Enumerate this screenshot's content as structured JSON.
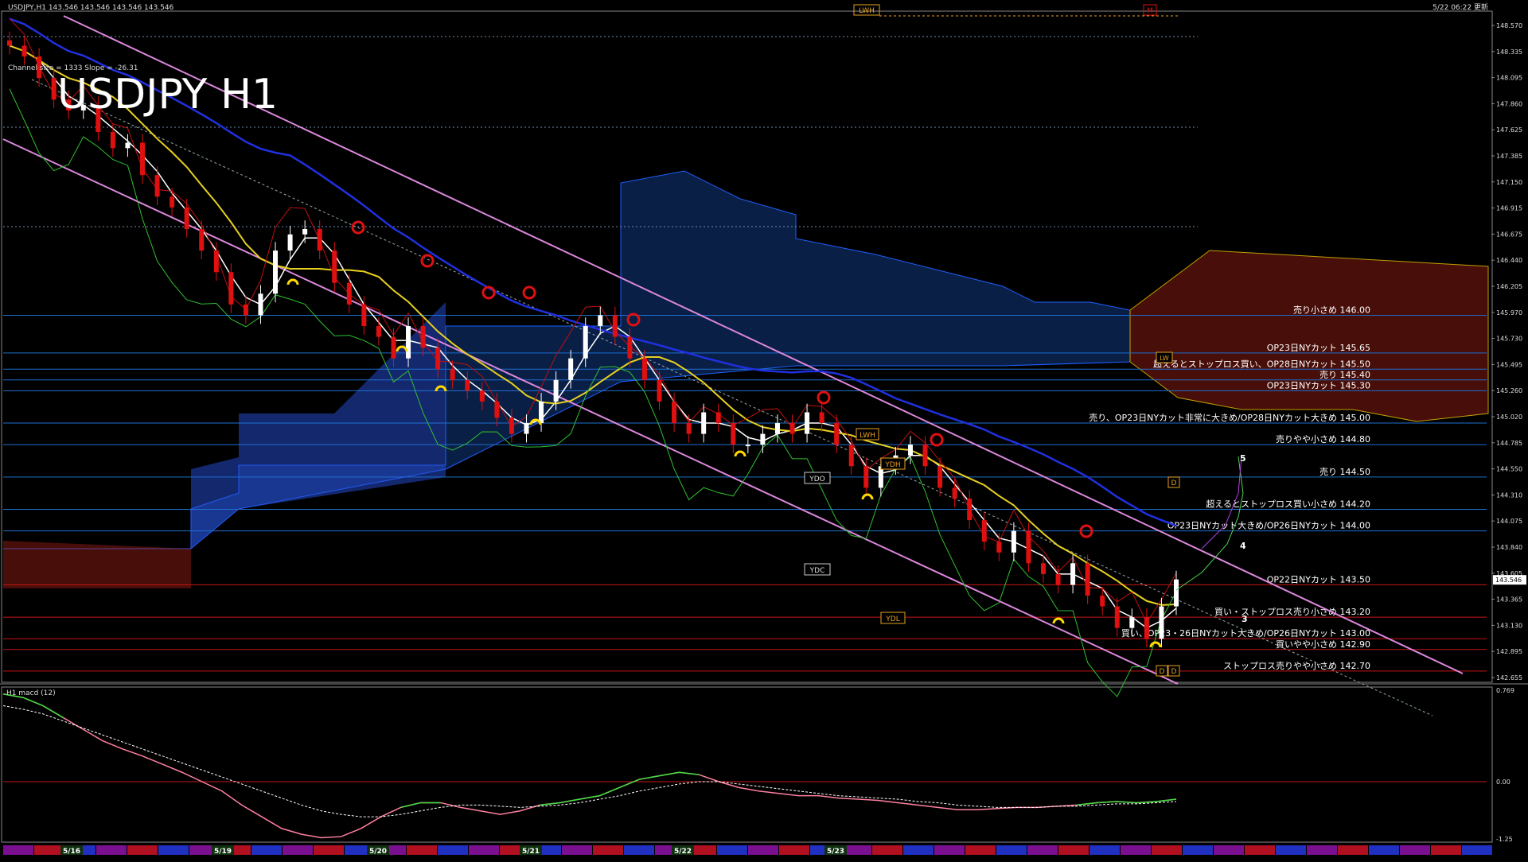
{
  "header": {
    "symbol_info": "USDJPY,H1  143.546 143.546 143.546 143.546",
    "updated": "5/22 06:22 更新",
    "watermark": "USDJPY H1",
    "channel_info": "Channel size = 1333 Slope = -26.31"
  },
  "markers": {
    "lwh": "LWH",
    "m": "M",
    "lw": "LW",
    "ydh": "YDH",
    "ydl": "YDL",
    "ydo": "YDO",
    "ydc": "YDC",
    "lwh2": "LWH",
    "d1": "D",
    "d2": "D",
    "d3": "D",
    "wave5": "5",
    "wave4": "4",
    "wave3": "3"
  },
  "colors": {
    "background": "#000000",
    "resistance": "#1e6fd0",
    "support": "#c81414",
    "channel": "#dd88dd",
    "bull_candle": "#ffffff",
    "bear_candle": "#e01010",
    "signal_sell": "#e01010",
    "signal_buy": "#ffd800",
    "macd": "#ff80a0",
    "macd_signal": "#ffffff",
    "macd_up": "#40e040"
  },
  "chart_data": [
    {
      "type": "line",
      "title": "USDJPY H1",
      "price_axis": [
        "148.570",
        "148.335",
        "148.095",
        "147.860",
        "147.625",
        "147.385",
        "147.150",
        "146.915",
        "146.675",
        "146.440",
        "146.205",
        "145.970",
        "145.730",
        "145.495",
        "145.260",
        "145.020",
        "144.785",
        "144.550",
        "144.310",
        "144.075",
        "143.840",
        "143.605",
        "143.365",
        "143.130",
        "142.895",
        "142.655"
      ],
      "current_price": "143.546",
      "ylim": [
        142.655,
        148.57
      ],
      "x_labels": [
        "5/16",
        "5/19",
        "5/20",
        "5/21",
        "5/22",
        "5/23"
      ],
      "levels": [
        {
          "label": "売り小さめ 146.00",
          "price": 146.0,
          "side": "sell"
        },
        {
          "label": "OP23日NYカット 145.65",
          "price": 145.65,
          "side": "sell"
        },
        {
          "label": "超えるとストップロス買い、OP28日NYカット 145.50",
          "price": 145.5,
          "side": "sell"
        },
        {
          "label": "売り 145.40",
          "price": 145.4,
          "side": "sell"
        },
        {
          "label": "OP23日NYカット 145.30",
          "price": 145.3,
          "side": "sell"
        },
        {
          "label": "売り、OP23日NYカット非常に大きめ/OP28日NYカット大きめ 145.00",
          "price": 145.0,
          "side": "sell"
        },
        {
          "label": "売りやや小さめ 144.80",
          "price": 144.8,
          "side": "sell"
        },
        {
          "label": "売り 144.50",
          "price": 144.5,
          "side": "sell"
        },
        {
          "label": "超えるとストップロス買い小さめ 144.20",
          "price": 144.2,
          "side": "sell"
        },
        {
          "label": "OP23日NYカット大きめ/OP26日NYカット 144.00",
          "price": 144.0,
          "side": "sell"
        },
        {
          "label": "OP22日NYカット 143.50",
          "price": 143.5,
          "side": "buy"
        },
        {
          "label": "買い・ストップロス売り小さめ 143.20",
          "price": 143.2,
          "side": "buy"
        },
        {
          "label": "買い、OP23・26日NYカット大きめ/OP26日NYカット 143.00",
          "price": 143.0,
          "side": "buy"
        },
        {
          "label": "買いやや小さめ 142.90",
          "price": 142.9,
          "side": "buy"
        },
        {
          "label": "ストップロス売りやや小さめ 142.70",
          "price": 142.7,
          "side": "buy"
        }
      ],
      "close_series": [
        148.5,
        148.4,
        148.2,
        148.0,
        147.9,
        147.95,
        147.7,
        147.55,
        147.6,
        147.3,
        147.1,
        147.0,
        146.8,
        146.6,
        146.4,
        146.1,
        146.0,
        146.2,
        146.6,
        146.75,
        146.8,
        146.6,
        146.3,
        146.1,
        145.9,
        145.8,
        145.6,
        145.9,
        145.7,
        145.5,
        145.4,
        145.3,
        145.2,
        145.05,
        144.9,
        145.0,
        145.2,
        145.4,
        145.6,
        145.9,
        146.0,
        145.8,
        145.6,
        145.4,
        145.2,
        145.0,
        144.9,
        145.1,
        145.0,
        144.8,
        144.8,
        144.9,
        145.0,
        144.9,
        145.1,
        145.0,
        144.8,
        144.6,
        144.4,
        144.6,
        144.7,
        144.8,
        144.6,
        144.4,
        144.3,
        144.1,
        143.9,
        143.8,
        144.0,
        143.7,
        143.6,
        143.5,
        143.7,
        143.4,
        143.3,
        143.1,
        143.2,
        143.0,
        143.3,
        143.55
      ],
      "ylim_note": "",
      "subchart": {
        "name": "H1 macd (12)",
        "axis": [
          "0.769",
          "0.00",
          "-1.25"
        ],
        "macd": [
          0.75,
          0.72,
          0.65,
          0.55,
          0.45,
          0.35,
          0.28,
          0.22,
          0.15,
          0.08,
          0.0,
          -0.08,
          -0.2,
          -0.3,
          -0.4,
          -0.45,
          -0.48,
          -0.47,
          -0.4,
          -0.3,
          -0.22,
          -0.18,
          -0.18,
          -0.22,
          -0.25,
          -0.28,
          -0.25,
          -0.2,
          -0.18,
          -0.15,
          -0.12,
          -0.05,
          0.02,
          0.05,
          0.08,
          0.06,
          0.0,
          -0.05,
          -0.08,
          -0.1,
          -0.12,
          -0.12,
          -0.14,
          -0.15,
          -0.16,
          -0.18,
          -0.2,
          -0.22,
          -0.24,
          -0.24,
          -0.23,
          -0.22,
          -0.22,
          -0.21,
          -0.2,
          -0.18,
          -0.17,
          -0.18,
          -0.17,
          -0.15
        ],
        "signal": [
          0.65,
          0.62,
          0.58,
          0.52,
          0.46,
          0.4,
          0.34,
          0.28,
          0.22,
          0.16,
          0.1,
          0.04,
          -0.02,
          -0.08,
          -0.14,
          -0.2,
          -0.25,
          -0.28,
          -0.3,
          -0.3,
          -0.28,
          -0.25,
          -0.22,
          -0.2,
          -0.2,
          -0.21,
          -0.22,
          -0.21,
          -0.2,
          -0.18,
          -0.15,
          -0.12,
          -0.08,
          -0.05,
          -0.02,
          0.0,
          0.0,
          -0.02,
          -0.04,
          -0.06,
          -0.08,
          -0.1,
          -0.12,
          -0.13,
          -0.14,
          -0.15,
          -0.17,
          -0.18,
          -0.2,
          -0.21,
          -0.22,
          -0.22,
          -0.22,
          -0.21,
          -0.21,
          -0.2,
          -0.19,
          -0.19,
          -0.18,
          -0.17
        ]
      }
    }
  ]
}
